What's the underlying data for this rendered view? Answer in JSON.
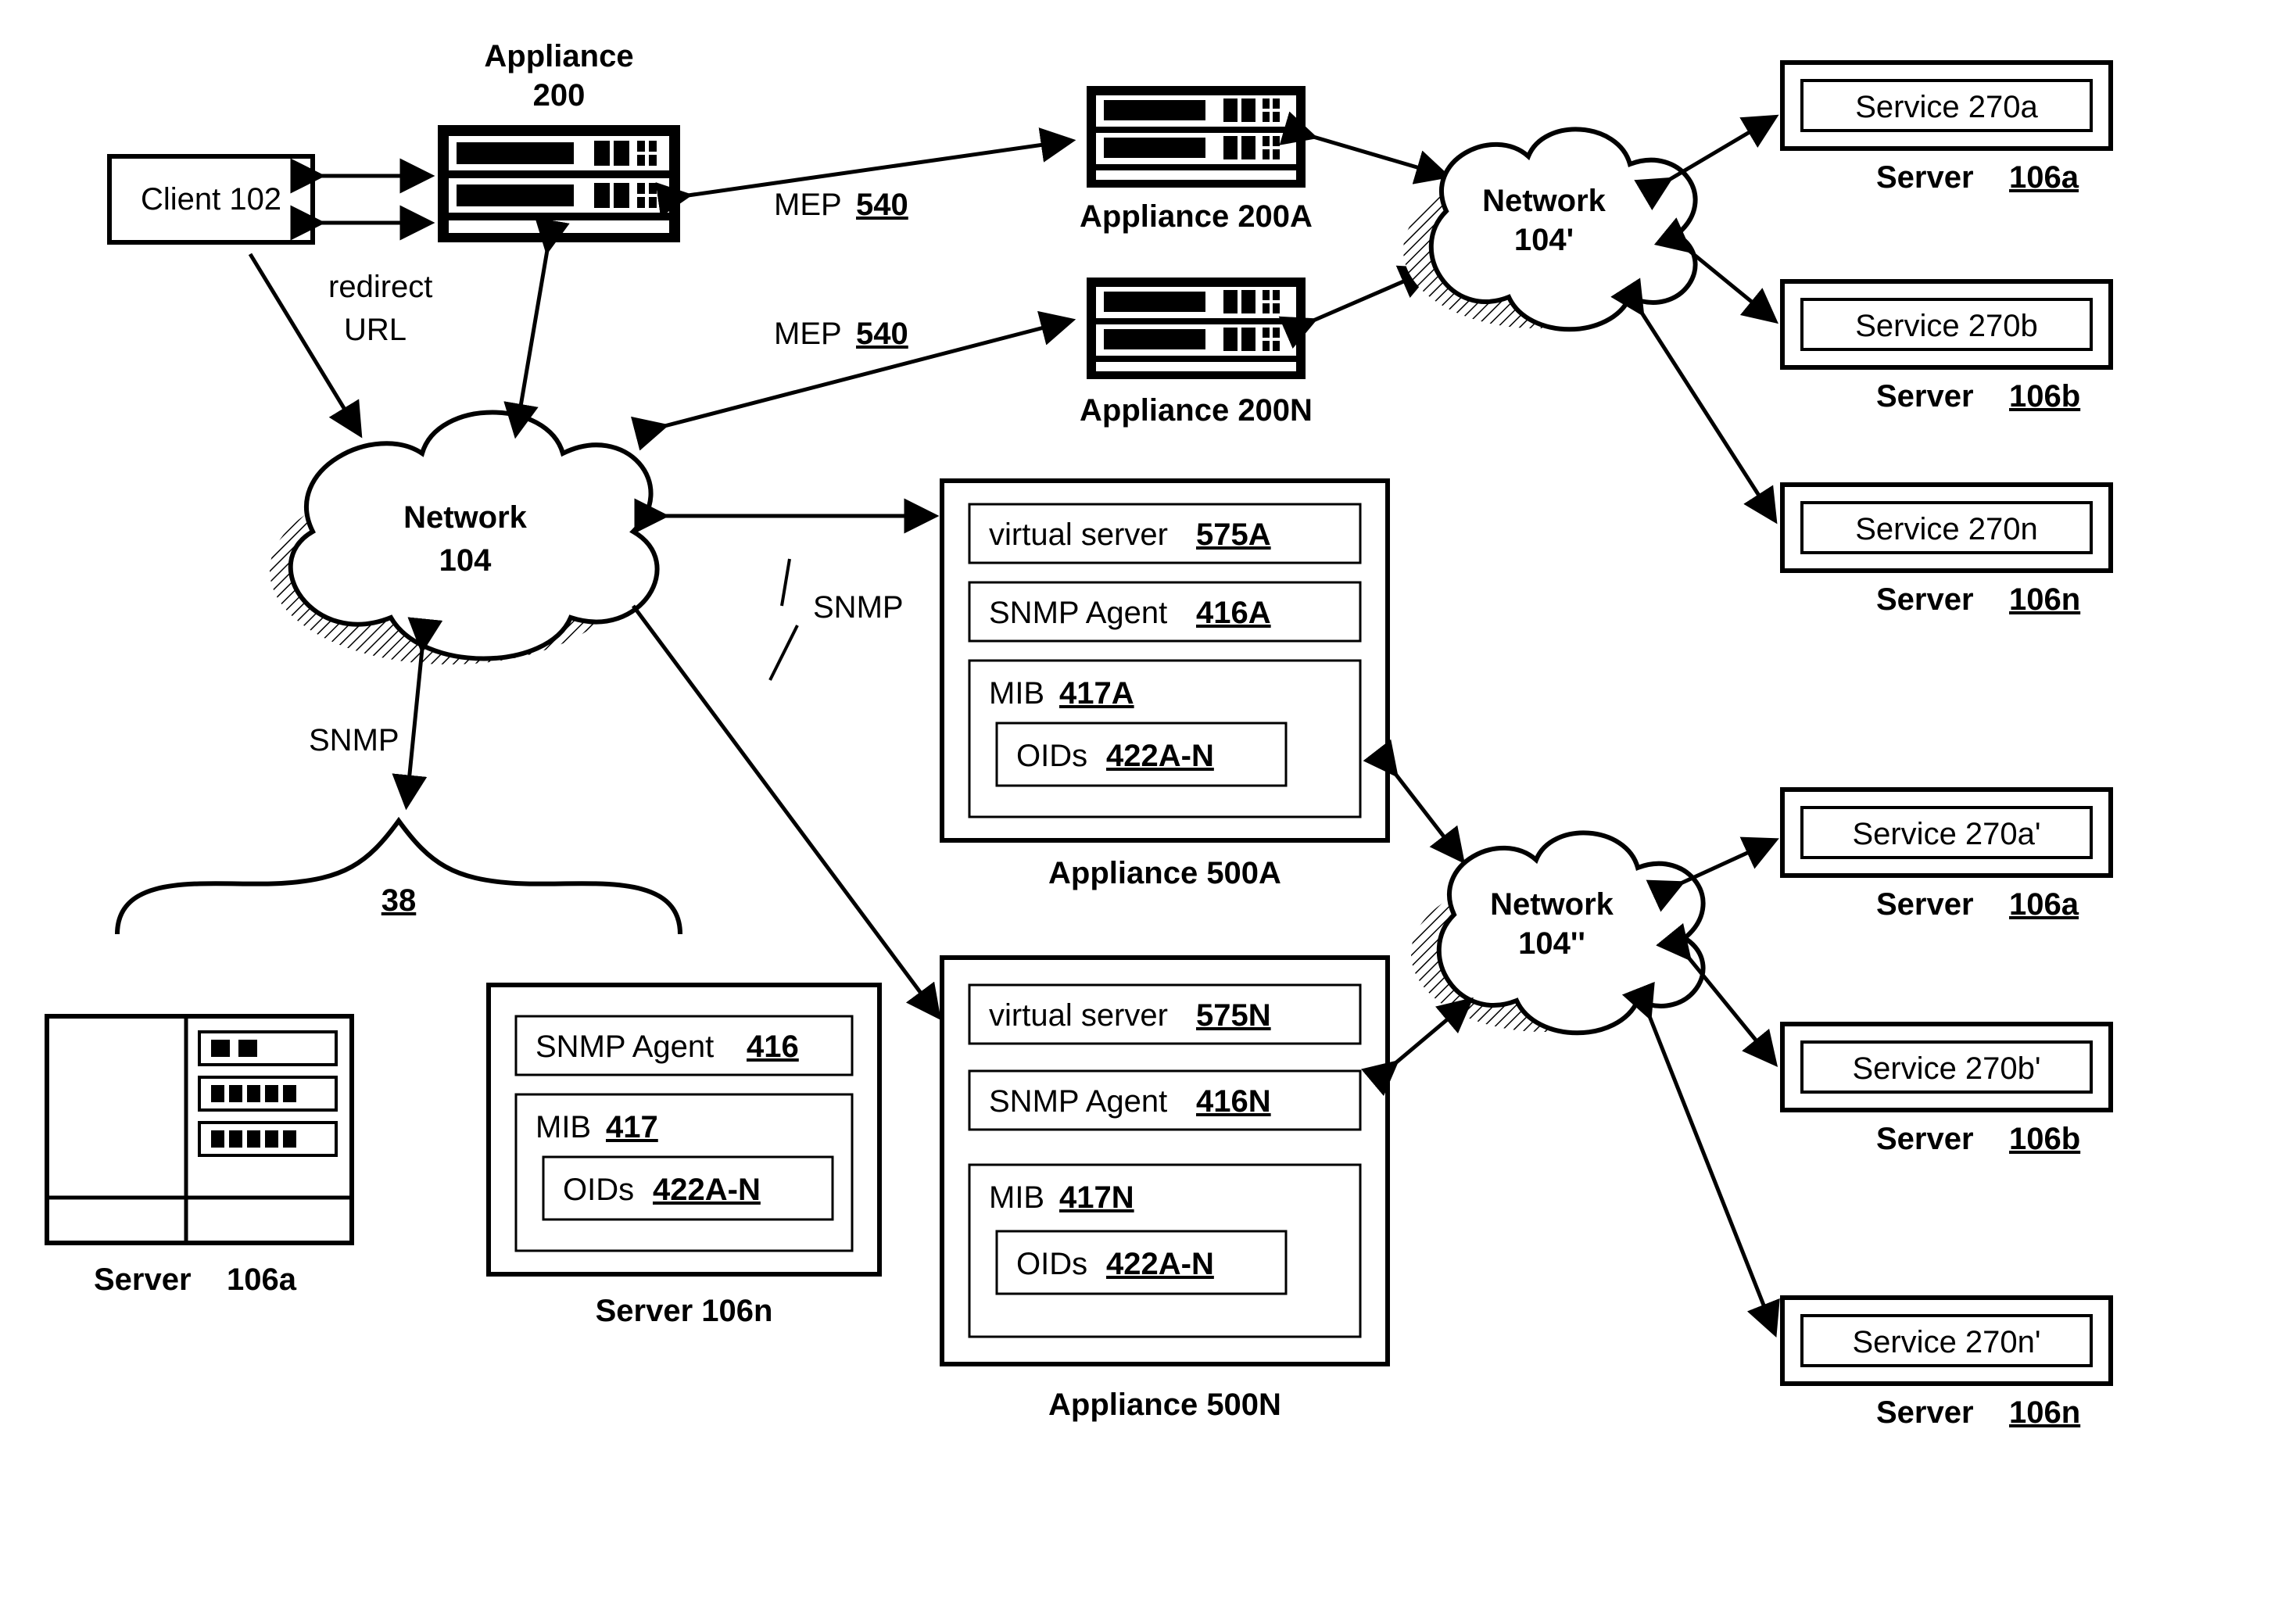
{
  "labels": {
    "client": "Client 102",
    "appliance_main_label": "Appliance",
    "appliance_main_num": "200",
    "redirect": "redirect",
    "url": "URL",
    "mep1": "MEP",
    "mep1_num": "540",
    "mep2": "MEP",
    "mep2_num": "540",
    "appliance_a": "Appliance 200A",
    "appliance_n": "Appliance 200N",
    "net1_title": "Network",
    "net1_num": "104",
    "net2_title": "Network",
    "net2_num": "104'",
    "net3_title": "Network",
    "net3_num": "104''",
    "snmp_left": "SNMP",
    "snmp_right": "SNMP",
    "brace_num": "38",
    "server_106a_left": "Server",
    "server_106a_left_num": "106a",
    "server106n_title": "Server 106n",
    "snmp_agent_416": "SNMP Agent",
    "snmp_agent_416_num": "416",
    "mib_417": "MIB",
    "mib_417_num": "417",
    "oids_422": "OIDs",
    "oids_422_num": "422A-N",
    "appliance500a_title": "Appliance 500A",
    "virtual_575a": "virtual server",
    "virtual_575a_num": "575A",
    "snmp_agent_416a": "SNMP Agent",
    "snmp_agent_416a_num": "416A",
    "mib_417a": "MIB",
    "mib_417a_num": "417A",
    "oids_422a": "OIDs",
    "oids_422a_num": "422A-N",
    "appliance500n_title": "Appliance 500N",
    "virtual_575n": "virtual server",
    "virtual_575n_num": "575N",
    "snmp_agent_416n": "SNMP Agent",
    "snmp_agent_416n_num": "416N",
    "mib_417n": "MIB",
    "mib_417n_num": "417N",
    "oids_422n": "OIDs",
    "oids_422n_num": "422A-N",
    "svc270a": "Service 270a",
    "svc270b": "Service 270b",
    "svc270n": "Service 270n",
    "srv106a": "Server",
    "srv106a_num": "106a",
    "srv106b": "Server",
    "srv106b_num": "106b",
    "srv106n": "Server",
    "srv106n_num": "106n",
    "svc270a2": "Service 270a'",
    "svc270b2": "Service 270b'",
    "svc270n2": "Service 270n'",
    "srv106a2": "Server",
    "srv106a2_num": "106a",
    "srv106b2": "Server",
    "srv106b2_num": "106b",
    "srv106n2": "Server",
    "srv106n2_num": "106n"
  }
}
